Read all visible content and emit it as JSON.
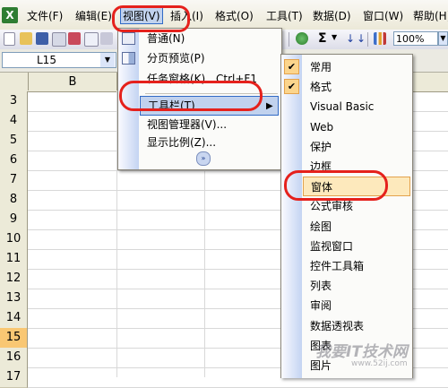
{
  "menubar": {
    "app_icon": "excel-icon",
    "items": [
      {
        "label": "文件(F)"
      },
      {
        "label": "编辑(E)"
      },
      {
        "label": "视图(V)"
      },
      {
        "label": "插入(I)"
      },
      {
        "label": "格式(O)"
      },
      {
        "label": "工具(T)"
      },
      {
        "label": "数据(D)"
      },
      {
        "label": "窗口(W)"
      },
      {
        "label": "帮助(H)"
      }
    ]
  },
  "toolbar": {
    "sum_symbol": "Σ",
    "zoom": "100%"
  },
  "formula_bar": {
    "name_box": "L15"
  },
  "sheet": {
    "column_headers": [
      "B"
    ],
    "row_numbers": [
      "3",
      "4",
      "5",
      "6",
      "7",
      "8",
      "9",
      "10",
      "11",
      "12",
      "13",
      "14",
      "15",
      "16",
      "17"
    ],
    "selected_row": "15"
  },
  "view_menu": {
    "items": [
      {
        "label": "普通(N)",
        "icon": "normal-view-icon"
      },
      {
        "label": "分页预览(P)",
        "icon": "page-break-icon"
      },
      {
        "label": "任务窗格(K)",
        "shortcut": "Ctrl+F1"
      },
      {
        "label": "工具栏(T)",
        "highlighted": true,
        "has_submenu": true
      },
      {
        "label": "视图管理器(V)..."
      },
      {
        "label": "显示比例(Z)..."
      }
    ],
    "expand_icon": "expand-chevron-icon"
  },
  "toolbars_submenu": {
    "items": [
      {
        "label": "常用",
        "checked": true
      },
      {
        "label": "格式",
        "checked": true
      },
      {
        "label": "Visual Basic",
        "checked": false
      },
      {
        "label": "Web",
        "checked": false
      },
      {
        "label": "保护",
        "checked": false
      },
      {
        "label": "边框",
        "checked": false
      },
      {
        "label": "窗体",
        "checked": false,
        "highlighted": true
      },
      {
        "label": "公式审核",
        "checked": false
      },
      {
        "label": "绘图",
        "checked": false
      },
      {
        "label": "监视窗口",
        "checked": false
      },
      {
        "label": "控件工具箱",
        "checked": false
      },
      {
        "label": "列表",
        "checked": false
      },
      {
        "label": "审阅",
        "checked": false
      },
      {
        "label": "数据透视表",
        "checked": false
      },
      {
        "label": "图表",
        "checked": false
      },
      {
        "label": "图片",
        "checked": false
      }
    ]
  },
  "watermark": {
    "text": "我要IT技术网",
    "url": "www.52ij.com"
  },
  "colors": {
    "annotation_red": "#e5211c",
    "menu_highlight": "#c1d2ee",
    "submenu_highlight": "#fde9bc",
    "selected_row": "#f9c773"
  }
}
